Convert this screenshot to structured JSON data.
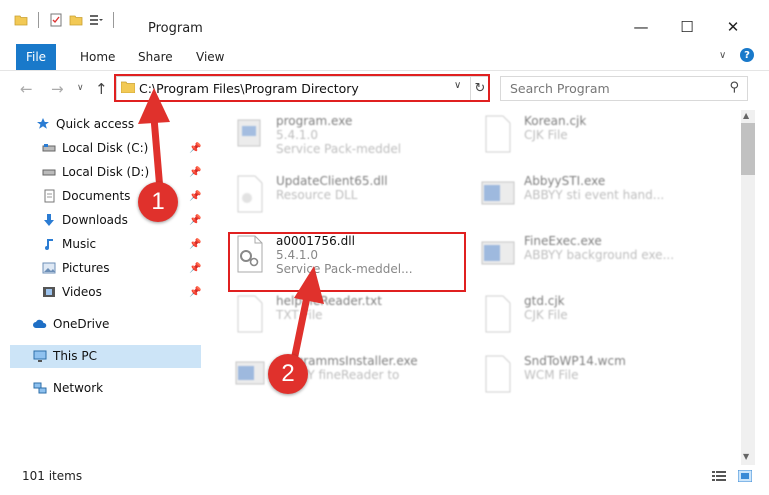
{
  "window": {
    "title": "Program",
    "minimize": "—",
    "maximize": "☐",
    "close": "✕"
  },
  "ribbon": {
    "tabs": [
      "File",
      "Home",
      "Share",
      "View"
    ],
    "help": "?"
  },
  "address": {
    "path": "C:\\Program Files\\Program Directory"
  },
  "search": {
    "placeholder": "Search Program"
  },
  "sidebar": {
    "items": [
      {
        "label": "Quick access",
        "icon": "star-icon"
      },
      {
        "label": "Local Disk (C:)",
        "icon": "drive-icon"
      },
      {
        "label": "Local Disk (D:)",
        "icon": "drive-icon"
      },
      {
        "label": "Documents",
        "icon": "documents-icon"
      },
      {
        "label": "Downloads",
        "icon": "download-icon"
      },
      {
        "label": "Music",
        "icon": "music-icon"
      },
      {
        "label": "Pictures",
        "icon": "pictures-icon"
      },
      {
        "label": "Videos",
        "icon": "videos-icon"
      },
      {
        "label": "OneDrive",
        "icon": "cloud-icon"
      },
      {
        "label": "This PC",
        "icon": "computer-icon"
      },
      {
        "label": "Network",
        "icon": "network-icon"
      }
    ]
  },
  "files": {
    "left": [
      {
        "name": "program.exe",
        "line2": "5.4.1.0",
        "line3": "Service Pack-meddel"
      },
      {
        "name": "UpdateClient65.dll",
        "line2": "Resource DLL",
        "line3": ""
      },
      {
        "name": "a0001756.dll",
        "line2": "5.4.1.0",
        "line3": "Service Pack-meddel..."
      },
      {
        "name": "helpfileReader.txt",
        "line2": "TXT File",
        "line3": ""
      },
      {
        "name": "programmsInstaller.exe",
        "line2": "ABBYY fineReader to",
        "line3": ""
      }
    ],
    "right": [
      {
        "name": "Korean.cjk",
        "line2": "CJK File"
      },
      {
        "name": "AbbyySTI.exe",
        "line2": "ABBYY sti event hand..."
      },
      {
        "name": "FineExec.exe",
        "line2": "ABBYY background exe..."
      },
      {
        "name": "gtd.cjk",
        "line2": "CJK File"
      },
      {
        "name": "SndToWP14.wcm",
        "line2": "WCM File"
      }
    ]
  },
  "status": {
    "count": "101 items"
  },
  "callouts": {
    "one": "1",
    "two": "2"
  },
  "colors": {
    "accent": "#1979ca",
    "highlight": "#e02020",
    "callout": "#e0312c",
    "selected_nav": "#cce4f7"
  }
}
